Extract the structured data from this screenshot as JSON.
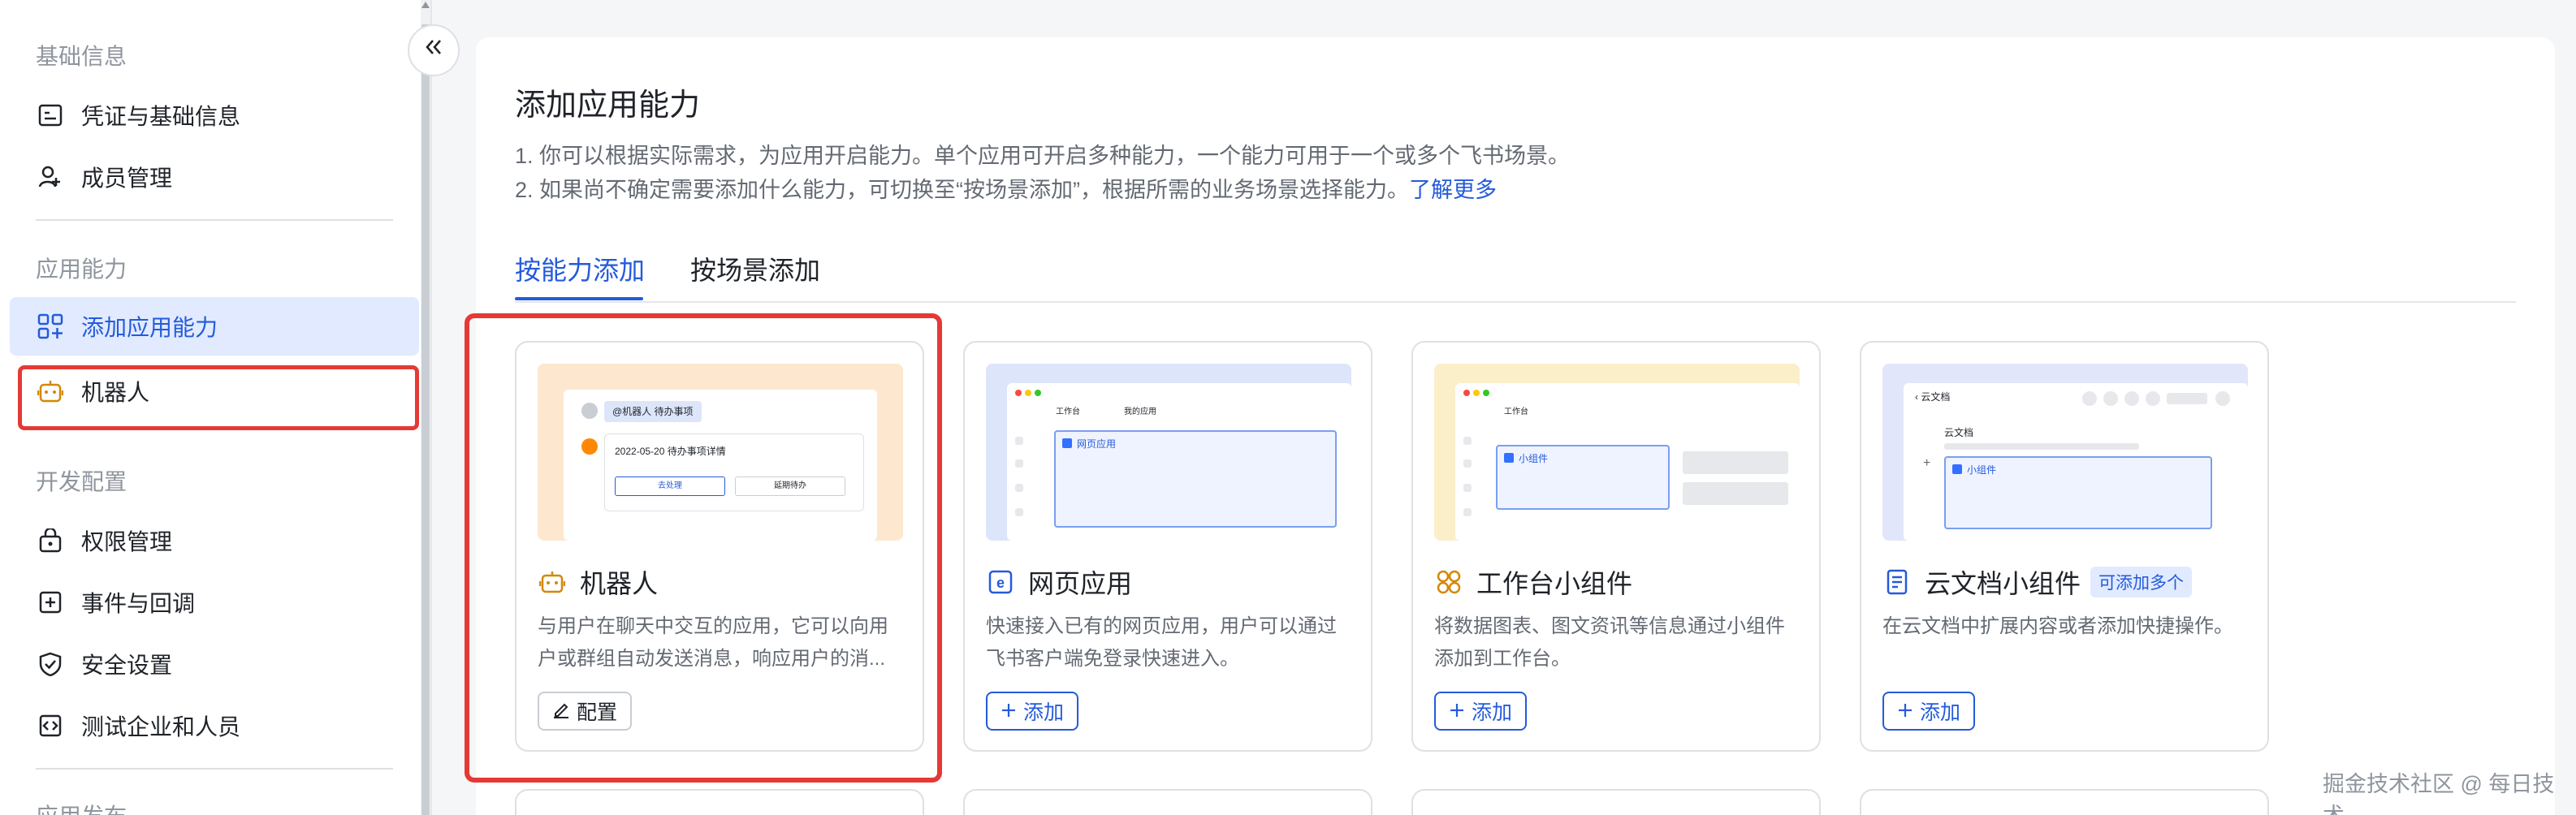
{
  "sidebar": {
    "sections": [
      {
        "title": "基础信息",
        "items": [
          {
            "label": "凭证与基础信息",
            "icon": "credential-icon"
          },
          {
            "label": "成员管理",
            "icon": "member-add-icon"
          }
        ]
      },
      {
        "title": "应用能力",
        "items": [
          {
            "label": "添加应用能力",
            "icon": "grid-add-icon",
            "active": true
          },
          {
            "label": "机器人",
            "icon": "robot-icon"
          }
        ]
      },
      {
        "title": "开发配置",
        "items": [
          {
            "label": "权限管理",
            "icon": "lock-icon"
          },
          {
            "label": "事件与回调",
            "icon": "event-icon"
          },
          {
            "label": "安全设置",
            "icon": "shield-icon"
          },
          {
            "label": "测试企业和人员",
            "icon": "code-icon"
          }
        ]
      },
      {
        "title": "应用发布"
      }
    ],
    "collapse_icon": "double-chevron-left-icon"
  },
  "main": {
    "title": "添加应用能力",
    "desc_line1": "1. 你可以根据实际需求，为应用开启能力。单个应用可开启多种能力，一个能力可用于一个或多个飞书场景。",
    "desc_line2": "2. 如果尚不确定需要添加什么能力，可切换至“按场景添加”，根据所需的业务场景选择能力。",
    "learn_more": "了解更多",
    "tabs": [
      {
        "label": "按能力添加",
        "active": true
      },
      {
        "label": "按场景添加",
        "active": false
      }
    ],
    "cards": [
      {
        "title": "机器人",
        "icon": "robot-icon",
        "desc": "与用户在聊天中交互的应用，它可以向用户或群组自动发送消息，响应用户的消...",
        "button": "配置",
        "button_icon": "edit-icon",
        "preview": {
          "bg": "#fde8cf",
          "chip": "@机器人 待办事项",
          "msg": "2022-05-20 待办事项详情",
          "btn1": "去处理",
          "btn2": "延期待办"
        }
      },
      {
        "title": "网页应用",
        "icon": "web-e-icon",
        "desc": "快速接入已有的网页应用，用户可以通过飞书客户端免登录快速进入。",
        "button": "添加",
        "button_icon": "plus-icon",
        "preview": {
          "bg": "#dde5fb",
          "tab1": "工作台",
          "tab2": "我的应用",
          "box": "网页应用"
        }
      },
      {
        "title": "工作台小组件",
        "icon": "widget-icon",
        "desc": "将数据图表、图文资讯等信息通过小组件添加到工作台。",
        "button": "添加",
        "button_icon": "plus-icon",
        "preview": {
          "bg": "#fbefc9",
          "tab1": "工作台",
          "box": "小组件"
        }
      },
      {
        "title": "云文档小组件",
        "icon": "doc-icon",
        "badge": "可添加多个",
        "desc": "在云文档中扩展内容或者添加快捷操作。",
        "button": "添加",
        "button_icon": "plus-icon",
        "preview": {
          "bg": "#e2e6fa",
          "header": "云文档",
          "heading": "云文档",
          "box": "小组件"
        }
      }
    ]
  },
  "watermark": "掘金技术社区 @ 每日技术",
  "colors": {
    "accent": "#245bdb",
    "highlight": "#e53935",
    "active_bg": "#e1eaff"
  }
}
